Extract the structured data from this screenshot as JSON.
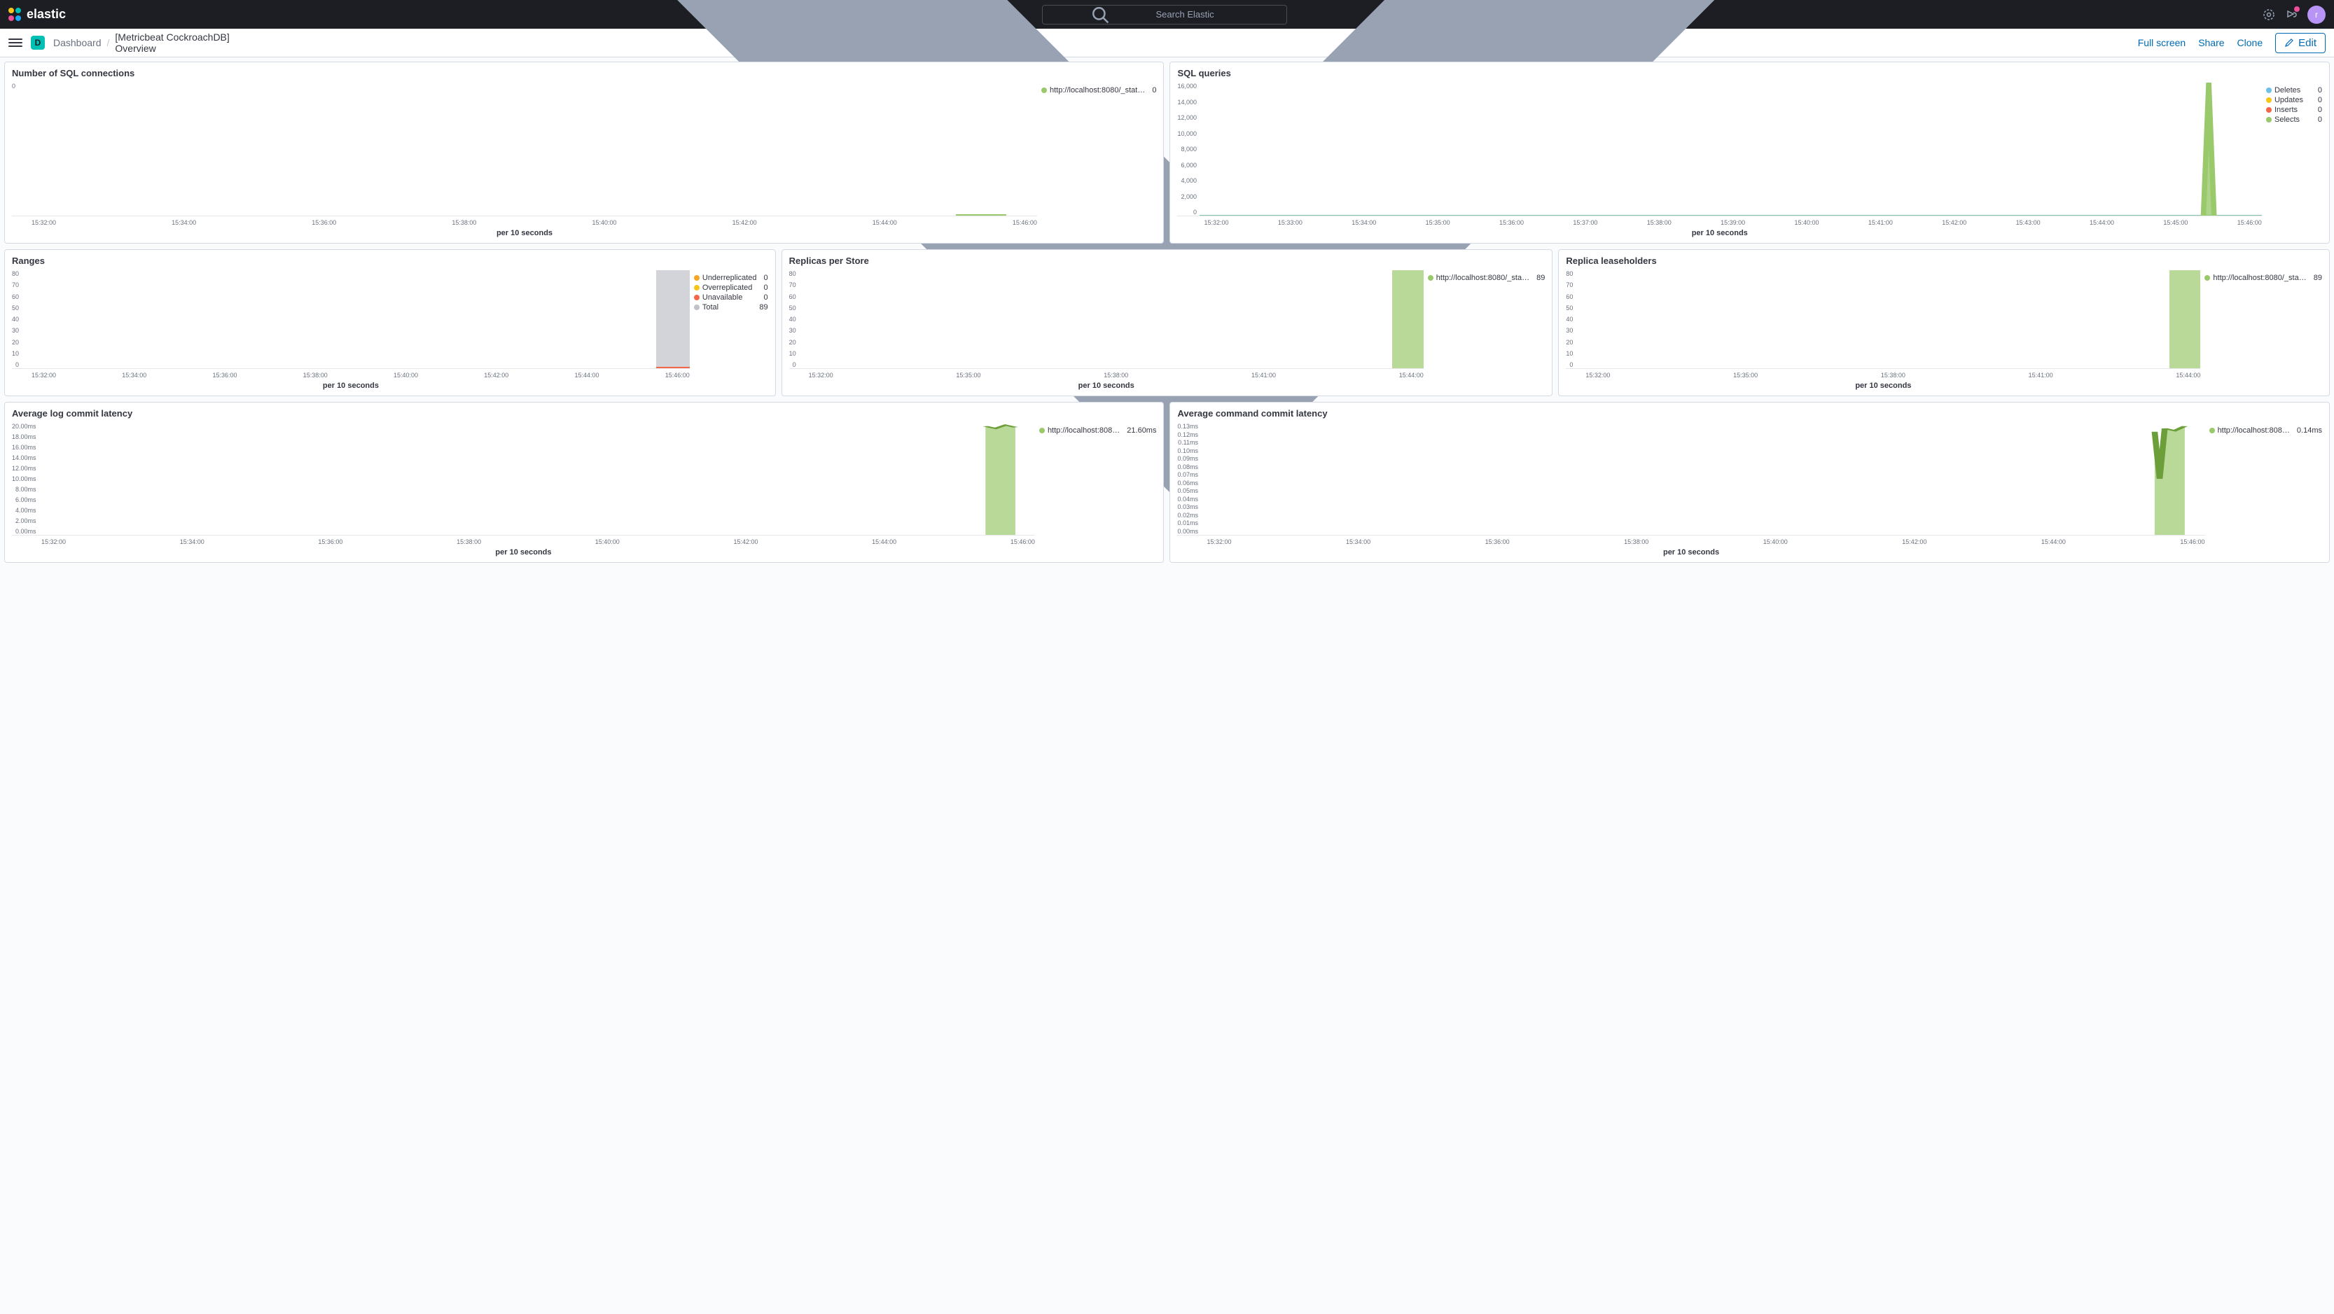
{
  "brand": "elastic",
  "search": {
    "placeholder": "Search Elastic"
  },
  "space_badge": "D",
  "avatar_initial": "r",
  "breadcrumb": {
    "root": "Dashboard",
    "current": "[Metricbeat CockroachDB] Overview"
  },
  "actions": {
    "fullscreen": "Full screen",
    "share": "Share",
    "clone": "Clone",
    "edit": "Edit"
  },
  "panels": {
    "sql_conn": {
      "title": "Number of SQL connections",
      "xlabel": "per 10 seconds",
      "legend": [
        {
          "label": "http://localhost:8080/_stat…",
          "value": "0",
          "color": "#9ac96b"
        }
      ],
      "yticks": [
        "0"
      ],
      "xticks": [
        "15:32:00",
        "15:34:00",
        "15:36:00",
        "15:38:00",
        "15:40:00",
        "15:42:00",
        "15:44:00",
        "15:46:00"
      ]
    },
    "sql_queries": {
      "title": "SQL queries",
      "xlabel": "per 10 seconds",
      "legend": [
        {
          "label": "Deletes",
          "value": "0",
          "color": "#6ec0e8"
        },
        {
          "label": "Updates",
          "value": "0",
          "color": "#f5c518"
        },
        {
          "label": "Inserts",
          "value": "0",
          "color": "#f56648"
        },
        {
          "label": "Selects",
          "value": "0",
          "color": "#9ac96b"
        }
      ],
      "yticks": [
        "16,000",
        "14,000",
        "12,000",
        "10,000",
        "8,000",
        "6,000",
        "4,000",
        "2,000",
        "0"
      ],
      "xticks": [
        "15:32:00",
        "15:33:00",
        "15:34:00",
        "15:35:00",
        "15:36:00",
        "15:37:00",
        "15:38:00",
        "15:39:00",
        "15:40:00",
        "15:41:00",
        "15:42:00",
        "15:43:00",
        "15:44:00",
        "15:45:00",
        "15:46:00"
      ]
    },
    "ranges": {
      "title": "Ranges",
      "xlabel": "per 10 seconds",
      "legend": [
        {
          "label": "Underreplicated",
          "value": "0",
          "color": "#f5a623"
        },
        {
          "label": "Overreplicated",
          "value": "0",
          "color": "#f5c518"
        },
        {
          "label": "Unavailable",
          "value": "0",
          "color": "#f56648"
        },
        {
          "label": "Total",
          "value": "89",
          "color": "#bfc2c9"
        }
      ],
      "yticks": [
        "80",
        "70",
        "60",
        "50",
        "40",
        "30",
        "20",
        "10",
        "0"
      ],
      "xticks": [
        "15:32:00",
        "15:34:00",
        "15:36:00",
        "15:38:00",
        "15:40:00",
        "15:42:00",
        "15:44:00",
        "15:46:00"
      ]
    },
    "replicas_per_store": {
      "title": "Replicas per Store",
      "xlabel": "per 10 seconds",
      "legend": [
        {
          "label": "http://localhost:8080/_sta…",
          "value": "89",
          "color": "#9ac96b"
        }
      ],
      "yticks": [
        "80",
        "70",
        "60",
        "50",
        "40",
        "30",
        "20",
        "10",
        "0"
      ],
      "xticks": [
        "15:32:00",
        "15:35:00",
        "15:38:00",
        "15:41:00",
        "15:44:00"
      ]
    },
    "replica_leaseholders": {
      "title": "Replica leaseholders",
      "xlabel": "per 10 seconds",
      "legend": [
        {
          "label": "http://localhost:8080/_sta…",
          "value": "89",
          "color": "#9ac96b"
        }
      ],
      "yticks": [
        "80",
        "70",
        "60",
        "50",
        "40",
        "30",
        "20",
        "10",
        "0"
      ],
      "xticks": [
        "15:32:00",
        "15:35:00",
        "15:38:00",
        "15:41:00",
        "15:44:00"
      ]
    },
    "avg_log_commit": {
      "title": "Average log commit latency",
      "xlabel": "per 10 seconds",
      "legend": [
        {
          "label": "http://localhost:808…",
          "value": "21.60ms",
          "color": "#9ac96b"
        }
      ],
      "yticks": [
        "20.00ms",
        "18.00ms",
        "16.00ms",
        "14.00ms",
        "12.00ms",
        "10.00ms",
        "8.00ms",
        "6.00ms",
        "4.00ms",
        "2.00ms",
        "0.00ms"
      ],
      "xticks": [
        "15:32:00",
        "15:34:00",
        "15:36:00",
        "15:38:00",
        "15:40:00",
        "15:42:00",
        "15:44:00",
        "15:46:00"
      ]
    },
    "avg_cmd_commit": {
      "title": "Average command commit latency",
      "xlabel": "per 10 seconds",
      "legend": [
        {
          "label": "http://localhost:808…",
          "value": "0.14ms",
          "color": "#9ac96b"
        }
      ],
      "yticks": [
        "0.13ms",
        "0.12ms",
        "0.11ms",
        "0.10ms",
        "0.09ms",
        "0.08ms",
        "0.07ms",
        "0.06ms",
        "0.05ms",
        "0.04ms",
        "0.03ms",
        "0.02ms",
        "0.01ms",
        "0.00ms"
      ],
      "xticks": [
        "15:32:00",
        "15:34:00",
        "15:36:00",
        "15:38:00",
        "15:40:00",
        "15:42:00",
        "15:44:00",
        "15:46:00"
      ]
    }
  },
  "chart_data": [
    {
      "panel": "sql_conn",
      "type": "area",
      "series": [
        {
          "name": "http://localhost:8080/_status/vars",
          "x_range": [
            "15:45:30",
            "15:46:30"
          ],
          "value": 0
        }
      ],
      "xlabel": "per 10 seconds",
      "ylim": [
        0,
        1
      ]
    },
    {
      "panel": "sql_queries",
      "type": "area",
      "series": [
        {
          "name": "Deletes",
          "baseline": 0,
          "spike_time": "15:45:40",
          "spike_value": 0
        },
        {
          "name": "Updates",
          "baseline": 0,
          "spike_time": "15:45:40",
          "spike_value": 0
        },
        {
          "name": "Inserts",
          "baseline": 0,
          "spike_time": "15:45:40",
          "spike_value": 0
        },
        {
          "name": "Selects",
          "baseline": 0,
          "spike_time": "15:45:40",
          "spike_value": 16000
        }
      ],
      "xlabel": "per 10 seconds",
      "ylim": [
        0,
        16000
      ]
    },
    {
      "panel": "ranges",
      "type": "area",
      "series": [
        {
          "name": "Underreplicated",
          "x_range": [
            "15:45:30",
            "15:46:30"
          ],
          "value": 0
        },
        {
          "name": "Overreplicated",
          "x_range": [
            "15:45:30",
            "15:46:30"
          ],
          "value": 0
        },
        {
          "name": "Unavailable",
          "x_range": [
            "15:45:30",
            "15:46:30"
          ],
          "value": 0
        },
        {
          "name": "Total",
          "x_range": [
            "15:45:30",
            "15:46:30"
          ],
          "value": 89
        }
      ],
      "xlabel": "per 10 seconds",
      "ylim": [
        0,
        90
      ]
    },
    {
      "panel": "replicas_per_store",
      "type": "area",
      "series": [
        {
          "name": "http://localhost:8080/_status/vars",
          "x_range": [
            "15:45:30",
            "15:46:30"
          ],
          "value": 89
        }
      ],
      "xlabel": "per 10 seconds",
      "ylim": [
        0,
        90
      ]
    },
    {
      "panel": "replica_leaseholders",
      "type": "area",
      "series": [
        {
          "name": "http://localhost:8080/_status/vars",
          "x_range": [
            "15:45:30",
            "15:46:30"
          ],
          "value": 89
        }
      ],
      "xlabel": "per 10 seconds",
      "ylim": [
        0,
        90
      ]
    },
    {
      "panel": "avg_log_commit",
      "type": "area",
      "series": [
        {
          "name": "http://localhost:8080/_status/vars",
          "x_range": [
            "15:45:30",
            "15:46:30"
          ],
          "value": 21.6,
          "unit": "ms"
        }
      ],
      "xlabel": "per 10 seconds",
      "ylim": [
        0,
        22
      ]
    },
    {
      "panel": "avg_cmd_commit",
      "type": "area",
      "series": [
        {
          "name": "http://localhost:8080/_status/vars",
          "x_range": [
            "15:45:30",
            "15:46:30"
          ],
          "value": 0.14,
          "unit": "ms",
          "dip_value": 0.07
        }
      ],
      "xlabel": "per 10 seconds",
      "ylim": [
        0,
        0.14
      ]
    }
  ]
}
